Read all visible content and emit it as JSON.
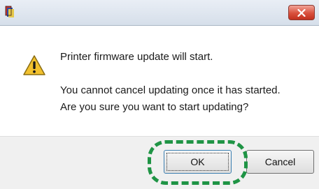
{
  "dialog": {
    "messages": [
      "Printer firmware update will start.",
      "You cannot cancel updating once it has started.",
      "Are you sure you want to start updating?"
    ],
    "icon": "warning-icon"
  },
  "titlebar": {
    "app_icon": "printer-app-icon",
    "close_icon": "close-icon"
  },
  "buttons": {
    "ok_label": "OK",
    "cancel_label": "Cancel"
  },
  "colors": {
    "highlight": "#1f9445",
    "close_button": "#d9503d",
    "warning": "#f2c12e"
  }
}
